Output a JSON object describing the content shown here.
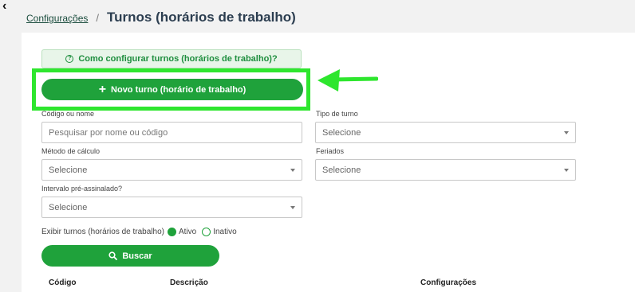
{
  "header": {
    "breadcrumb_link": "Configurações",
    "breadcrumb_sep": "/",
    "title": "Turnos (horários de trabalho)"
  },
  "help": {
    "label": "Como configurar turnos (horários de trabalho)?"
  },
  "actions": {
    "new_shift_label": "Novo turno (horário de trabalho)",
    "search_label": "Buscar"
  },
  "filters": {
    "code_or_name": {
      "label": "Código ou nome",
      "placeholder": "Pesquisar por nome ou código",
      "value": ""
    },
    "shift_type": {
      "label": "Tipo de turno",
      "value": "Selecione"
    },
    "calc_method": {
      "label": "Método de cálculo",
      "value": "Selecione"
    },
    "holidays": {
      "label": "Feriados",
      "value": "Selecione"
    },
    "pre_signed_interval": {
      "label": "Intervalo pré-assinalado?",
      "value": "Selecione"
    }
  },
  "display_toggle": {
    "label": "Exibir turnos (horários de trabalho)",
    "options": [
      {
        "label": "Ativo",
        "selected": true
      },
      {
        "label": "Inativo",
        "selected": false
      }
    ]
  },
  "table": {
    "columns": [
      "Código",
      "Descrição",
      "Configurações"
    ]
  },
  "colors": {
    "primary_green": "#1fa23b",
    "highlight_green": "#2ee62e",
    "help_bg": "#e8f5e9",
    "title": "#2c3e50"
  },
  "icons": {
    "back": "chevron-left-icon",
    "help": "question-circle-icon",
    "new_shift": "plus-icon",
    "search": "search-icon",
    "select_caret": "caret-down-icon",
    "annotation": "arrow-left-icon"
  }
}
